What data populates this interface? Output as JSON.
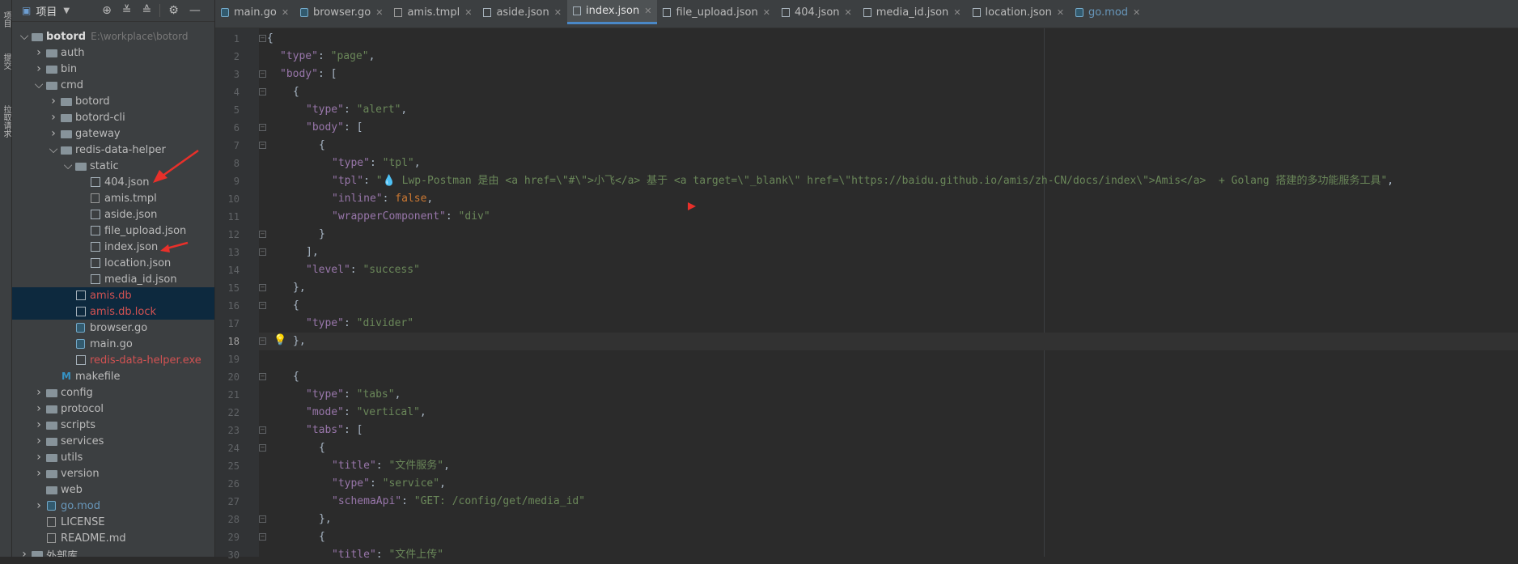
{
  "toolstrip": {
    "labels": [
      "项目",
      "提交",
      "拉取请求"
    ]
  },
  "project_panel": {
    "title": "项目",
    "tree": [
      {
        "label": "botord",
        "path": "E:\\workplace\\botord",
        "depth": 0,
        "type": "folder",
        "expanded": true,
        "style": "bold"
      },
      {
        "label": "auth",
        "depth": 1,
        "type": "folder",
        "expanded": false
      },
      {
        "label": "bin",
        "depth": 1,
        "type": "folder",
        "expanded": false
      },
      {
        "label": "cmd",
        "depth": 1,
        "type": "folder",
        "expanded": true
      },
      {
        "label": "botord",
        "depth": 2,
        "type": "folder",
        "expanded": false
      },
      {
        "label": "botord-cli",
        "depth": 2,
        "type": "folder",
        "expanded": false
      },
      {
        "label": "gateway",
        "depth": 2,
        "type": "folder",
        "expanded": false
      },
      {
        "label": "redis-data-helper",
        "depth": 2,
        "type": "folder",
        "expanded": true
      },
      {
        "label": "static",
        "depth": 3,
        "type": "folder",
        "expanded": true
      },
      {
        "label": "404.json",
        "depth": 4,
        "type": "json"
      },
      {
        "label": "amis.tmpl",
        "depth": 4,
        "type": "txt"
      },
      {
        "label": "aside.json",
        "depth": 4,
        "type": "json"
      },
      {
        "label": "file_upload.json",
        "depth": 4,
        "type": "json"
      },
      {
        "label": "index.json",
        "depth": 4,
        "type": "json"
      },
      {
        "label": "location.json",
        "depth": 4,
        "type": "json"
      },
      {
        "label": "media_id.json",
        "depth": 4,
        "type": "json"
      },
      {
        "label": "amis.db",
        "depth": 3,
        "type": "json",
        "style": "red",
        "selected": true
      },
      {
        "label": "amis.db.lock",
        "depth": 3,
        "type": "json",
        "style": "red",
        "selected": true
      },
      {
        "label": "browser.go",
        "depth": 3,
        "type": "go"
      },
      {
        "label": "main.go",
        "depth": 3,
        "type": "go"
      },
      {
        "label": "redis-data-helper.exe",
        "depth": 3,
        "type": "json",
        "style": "red"
      },
      {
        "label": "makefile",
        "depth": 2,
        "type": "make"
      },
      {
        "label": "config",
        "depth": 1,
        "type": "folder",
        "expanded": false
      },
      {
        "label": "protocol",
        "depth": 1,
        "type": "folder",
        "expanded": false
      },
      {
        "label": "scripts",
        "depth": 1,
        "type": "folder",
        "expanded": false
      },
      {
        "label": "services",
        "depth": 1,
        "type": "folder",
        "expanded": false
      },
      {
        "label": "utils",
        "depth": 1,
        "type": "folder",
        "expanded": false
      },
      {
        "label": "version",
        "depth": 1,
        "type": "folder",
        "expanded": false
      },
      {
        "label": "web",
        "depth": 1,
        "type": "folder",
        "leaf": true
      },
      {
        "label": "go.mod",
        "depth": 1,
        "type": "go",
        "style": "blue",
        "expandable": true
      },
      {
        "label": "LICENSE",
        "depth": 1,
        "type": "txt"
      },
      {
        "label": "README.md",
        "depth": 1,
        "type": "txt"
      },
      {
        "label": "外部库",
        "depth": 0,
        "type": "lib",
        "expanded": false
      }
    ]
  },
  "tabs": [
    {
      "label": "main.go",
      "icon": "go"
    },
    {
      "label": "browser.go",
      "icon": "go"
    },
    {
      "label": "amis.tmpl",
      "icon": "tpl"
    },
    {
      "label": "aside.json",
      "icon": "json"
    },
    {
      "label": "index.json",
      "icon": "json",
      "active": true
    },
    {
      "label": "file_upload.json",
      "icon": "json"
    },
    {
      "label": "404.json",
      "icon": "json"
    },
    {
      "label": "media_id.json",
      "icon": "json"
    },
    {
      "label": "location.json",
      "icon": "json"
    },
    {
      "label": "go.mod",
      "icon": "go",
      "style": "blue"
    }
  ],
  "editor": {
    "current_line": 18,
    "lines": [
      {
        "n": 1,
        "indent": 0,
        "tokens": [
          [
            "p",
            "{"
          ]
        ]
      },
      {
        "n": 2,
        "indent": 1,
        "tokens": [
          [
            "k",
            "\"type\""
          ],
          [
            "p",
            ": "
          ],
          [
            "s",
            "\"page\""
          ],
          [
            "p",
            ","
          ]
        ]
      },
      {
        "n": 3,
        "indent": 1,
        "tokens": [
          [
            "k",
            "\"body\""
          ],
          [
            "p",
            ": ["
          ]
        ]
      },
      {
        "n": 4,
        "indent": 2,
        "tokens": [
          [
            "p",
            "{"
          ]
        ]
      },
      {
        "n": 5,
        "indent": 3,
        "tokens": [
          [
            "k",
            "\"type\""
          ],
          [
            "p",
            ": "
          ],
          [
            "s",
            "\"alert\""
          ],
          [
            "p",
            ","
          ]
        ]
      },
      {
        "n": 6,
        "indent": 3,
        "tokens": [
          [
            "k",
            "\"body\""
          ],
          [
            "p",
            ": ["
          ]
        ]
      },
      {
        "n": 7,
        "indent": 4,
        "tokens": [
          [
            "p",
            "{"
          ]
        ]
      },
      {
        "n": 8,
        "indent": 5,
        "tokens": [
          [
            "k",
            "\"type\""
          ],
          [
            "p",
            ": "
          ],
          [
            "s",
            "\"tpl\""
          ],
          [
            "p",
            ","
          ]
        ]
      },
      {
        "n": 9,
        "indent": 5,
        "tokens": [
          [
            "k",
            "\"tpl\""
          ],
          [
            "p",
            ": "
          ],
          [
            "s",
            "\"💧 Lwp-Postman 是由 <a href=\\\"#\\\">小飞</a> 基于 <a target=\\\"_blank\\\" href=\\\"https://baidu.github.io/amis/zh-CN/docs/index\\\">Amis</a>  + Golang 搭建的多功能服务工具\""
          ],
          [
            "p",
            ","
          ]
        ]
      },
      {
        "n": 10,
        "indent": 5,
        "tokens": [
          [
            "k",
            "\"inline\""
          ],
          [
            "p",
            ": "
          ],
          [
            "w",
            "false"
          ],
          [
            "p",
            ","
          ]
        ]
      },
      {
        "n": 11,
        "indent": 5,
        "tokens": [
          [
            "k",
            "\"wrapperComponent\""
          ],
          [
            "p",
            ": "
          ],
          [
            "s",
            "\"div\""
          ]
        ]
      },
      {
        "n": 12,
        "indent": 4,
        "tokens": [
          [
            "p",
            "}"
          ]
        ]
      },
      {
        "n": 13,
        "indent": 3,
        "tokens": [
          [
            "p",
            "],"
          ]
        ]
      },
      {
        "n": 14,
        "indent": 3,
        "tokens": [
          [
            "k",
            "\"level\""
          ],
          [
            "p",
            ": "
          ],
          [
            "s",
            "\"success\""
          ]
        ]
      },
      {
        "n": 15,
        "indent": 2,
        "tokens": [
          [
            "p",
            "},"
          ]
        ]
      },
      {
        "n": 16,
        "indent": 2,
        "tokens": [
          [
            "p",
            "{"
          ]
        ]
      },
      {
        "n": 17,
        "indent": 3,
        "tokens": [
          [
            "k",
            "\"type\""
          ],
          [
            "p",
            ": "
          ],
          [
            "s",
            "\"divider\""
          ]
        ]
      },
      {
        "n": 18,
        "indent": 2,
        "tokens": [
          [
            "p",
            "},"
          ]
        ]
      },
      {
        "n": 19,
        "indent": 0,
        "tokens": []
      },
      {
        "n": 20,
        "indent": 2,
        "tokens": [
          [
            "p",
            "{"
          ]
        ]
      },
      {
        "n": 21,
        "indent": 3,
        "tokens": [
          [
            "k",
            "\"type\""
          ],
          [
            "p",
            ": "
          ],
          [
            "s",
            "\"tabs\""
          ],
          [
            "p",
            ","
          ]
        ]
      },
      {
        "n": 22,
        "indent": 3,
        "tokens": [
          [
            "k",
            "\"mode\""
          ],
          [
            "p",
            ": "
          ],
          [
            "s",
            "\"vertical\""
          ],
          [
            "p",
            ","
          ]
        ]
      },
      {
        "n": 23,
        "indent": 3,
        "tokens": [
          [
            "k",
            "\"tabs\""
          ],
          [
            "p",
            ": ["
          ]
        ]
      },
      {
        "n": 24,
        "indent": 4,
        "tokens": [
          [
            "p",
            "{"
          ]
        ]
      },
      {
        "n": 25,
        "indent": 5,
        "tokens": [
          [
            "k",
            "\"title\""
          ],
          [
            "p",
            ": "
          ],
          [
            "s",
            "\"文件服务\""
          ],
          [
            "p",
            ","
          ]
        ]
      },
      {
        "n": 26,
        "indent": 5,
        "tokens": [
          [
            "k",
            "\"type\""
          ],
          [
            "p",
            ": "
          ],
          [
            "s",
            "\"service\""
          ],
          [
            "p",
            ","
          ]
        ]
      },
      {
        "n": 27,
        "indent": 5,
        "tokens": [
          [
            "k",
            "\"schemaApi\""
          ],
          [
            "p",
            ": "
          ],
          [
            "s",
            "\"GET: /config/get/media_id\""
          ]
        ]
      },
      {
        "n": 28,
        "indent": 4,
        "tokens": [
          [
            "p",
            "},"
          ]
        ]
      },
      {
        "n": 29,
        "indent": 4,
        "tokens": [
          [
            "p",
            "{"
          ]
        ]
      },
      {
        "n": 30,
        "indent": 5,
        "tokens": [
          [
            "k",
            "\"title\""
          ],
          [
            "p",
            ": "
          ],
          [
            "s",
            "\"文件上传\""
          ]
        ]
      }
    ],
    "fold_lines": [
      1,
      3,
      4,
      6,
      7,
      12,
      13,
      15,
      16,
      18,
      20,
      23,
      24,
      28,
      29
    ]
  },
  "colors": {
    "key": "#9876aa",
    "string": "#6a8759",
    "keyword": "#cc7832",
    "punct": "#a9b7c6",
    "annotation_arrow": "#e8302a",
    "accent": "#4a88c7"
  }
}
